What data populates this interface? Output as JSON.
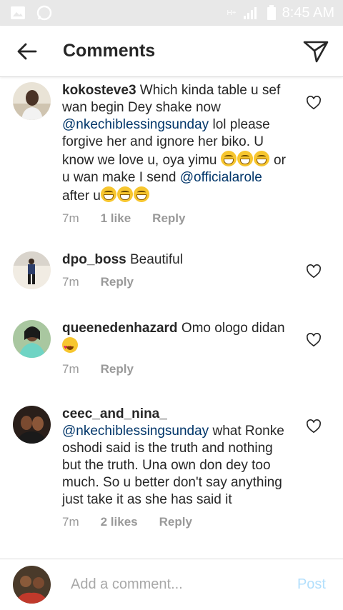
{
  "status_bar": {
    "time": "8:45 AM",
    "network": "H+"
  },
  "header": {
    "title": "Comments"
  },
  "comments": [
    {
      "username": "kokosteve3",
      "text_1": " Which kinda table u sef wan begin Dey shake now ",
      "mention_1": "@nkechiblessingsunday",
      "text_2": " lol please forgive her and ignore her biko. U know we love u, oya yimu ",
      "text_3": " or u wan make I send ",
      "mention_2": "@officialarole",
      "text_4": " after u",
      "time": "7m",
      "likes": "1 like",
      "reply": "Reply"
    },
    {
      "username": "dpo_boss",
      "text_1": " Beautiful",
      "time": "7m",
      "reply": "Reply"
    },
    {
      "username": "queenedenhazard",
      "text_1": " Omo ologo didan",
      "time": "7m",
      "reply": "Reply"
    },
    {
      "username": "ceec_and_nina_",
      "mention_1": "@nkechiblessingsunday",
      "text_1": " what Ronke oshodi said is the truth and nothing but the truth. Una own don dey too much. So u better don't say anything just take it as she has said it",
      "time": "7m",
      "likes": "2 likes",
      "reply": "Reply"
    }
  ],
  "composer": {
    "placeholder": "Add a comment...",
    "post_label": "Post"
  },
  "colors": {
    "mention": "#003569",
    "meta": "#999999",
    "post": "#b2dffc"
  },
  "icons": [
    "image-icon",
    "whatsapp-icon",
    "signal-icon",
    "battery-icon",
    "back-arrow-icon",
    "direct-share-icon",
    "heart-outline-icon",
    "laughing-emoji",
    "heart-eyes-emoji"
  ]
}
